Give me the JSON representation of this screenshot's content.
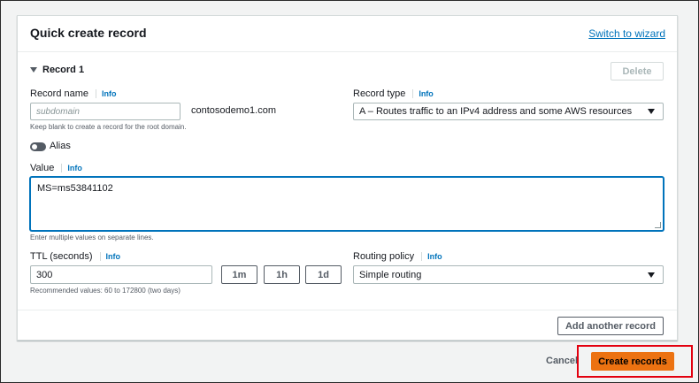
{
  "panel": {
    "title": "Quick create record",
    "switch_link": "Switch to wizard"
  },
  "record": {
    "header": "Record 1",
    "delete_label": "Delete",
    "record_name": {
      "label": "Record name",
      "info": "Info",
      "placeholder": "subdomain",
      "value": "",
      "domain_suffix": "contosodemo1.com",
      "hint": "Keep blank to create a record for the root domain."
    },
    "record_type": {
      "label": "Record type",
      "info": "Info",
      "selected": "A – Routes traffic to an IPv4 address and some AWS resources"
    },
    "alias": {
      "label": "Alias",
      "enabled": false
    },
    "value_field": {
      "label": "Value",
      "info": "Info",
      "value": "MS=ms53841102",
      "hint": "Enter multiple values on separate lines."
    },
    "ttl": {
      "label": "TTL (seconds)",
      "info": "Info",
      "value": "300",
      "presets": [
        "1m",
        "1h",
        "1d"
      ],
      "hint": "Recommended values: 60 to 172800 (two days)"
    },
    "routing_policy": {
      "label": "Routing policy",
      "info": "Info",
      "selected": "Simple routing"
    },
    "add_another_label": "Add another record"
  },
  "footer": {
    "cancel_label": "Cancel",
    "create_label": "Create records"
  },
  "colors": {
    "accent": "#0073bb",
    "primary_button": "#ec7211",
    "highlight_box": "#e3000f"
  }
}
